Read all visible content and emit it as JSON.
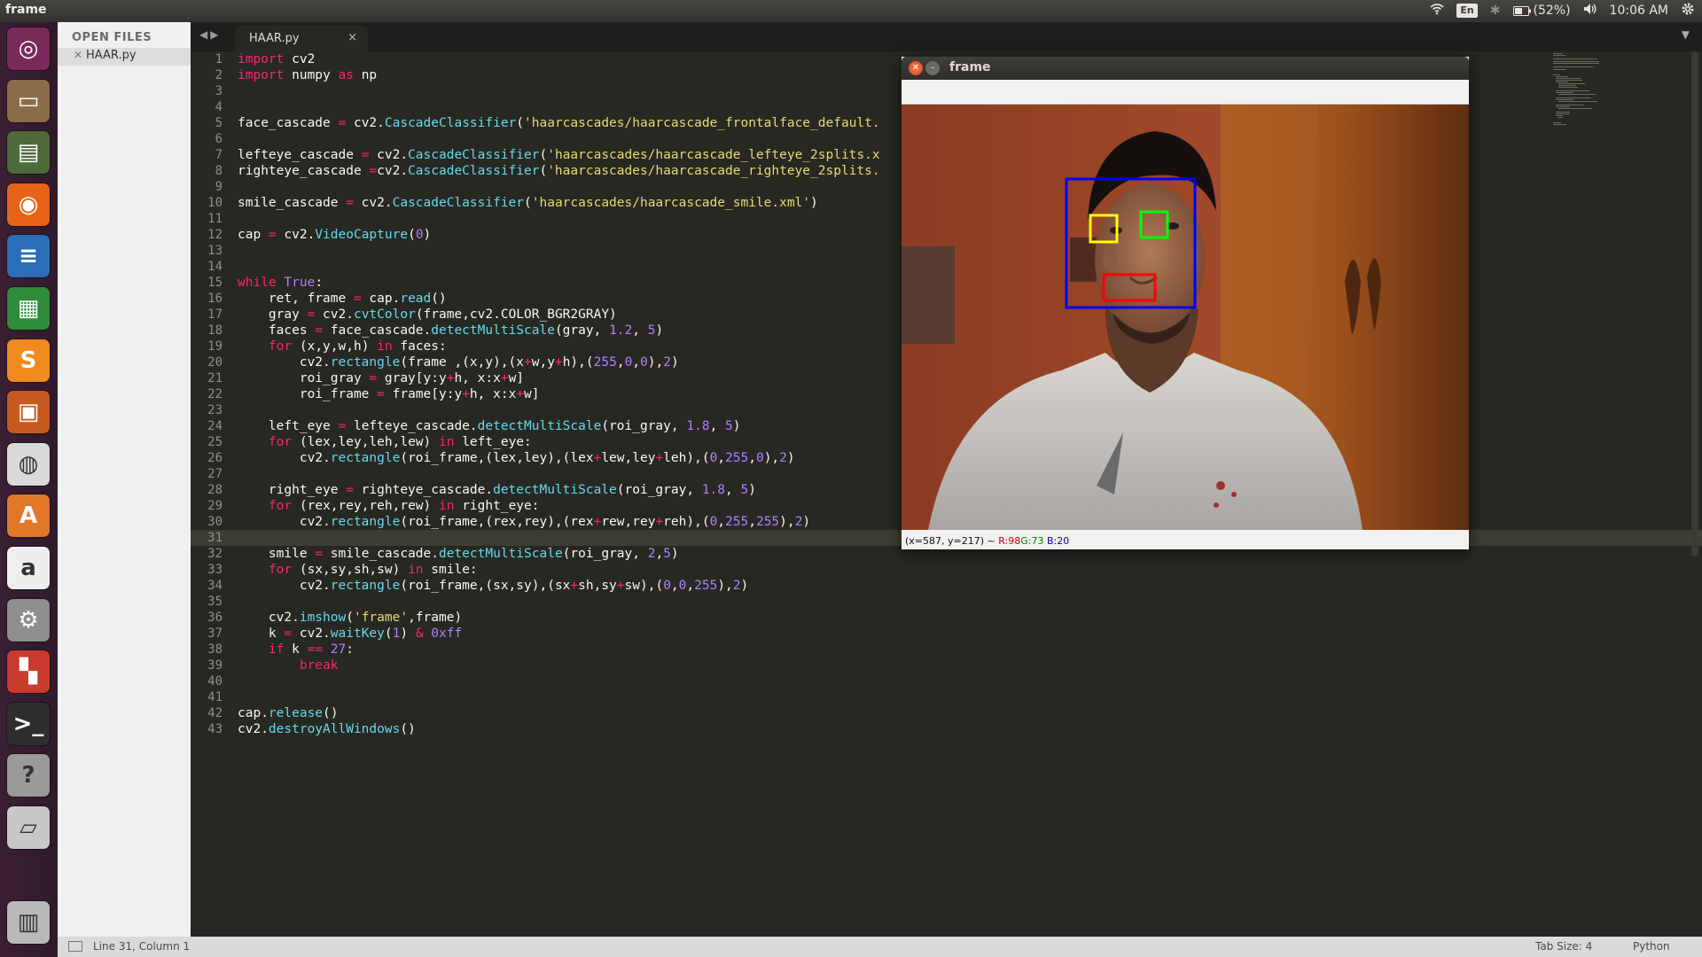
{
  "topbar": {
    "app_title": "frame",
    "keyboard_lang": "En",
    "battery": "(52%)",
    "clock": "10:06 AM"
  },
  "launcher": {
    "items": [
      {
        "name": "dash-icon",
        "bg": "#7a2a5a"
      },
      {
        "name": "files-icon",
        "bg": "#8a6e4a"
      },
      {
        "name": "disk-icon",
        "bg": "#4d6a3a"
      },
      {
        "name": "firefox-icon",
        "bg": "#e8631a"
      },
      {
        "name": "writer-icon",
        "bg": "#2a6fb8"
      },
      {
        "name": "calc-icon",
        "bg": "#2f8a3a"
      },
      {
        "name": "sublime-icon",
        "bg": "#f08a1c"
      },
      {
        "name": "impress-icon",
        "bg": "#c85a20"
      },
      {
        "name": "chrome-icon",
        "bg": "#d9d9d9"
      },
      {
        "name": "software-center-icon",
        "bg": "#e0782a"
      },
      {
        "name": "amazon-icon",
        "bg": "#eeeeee"
      },
      {
        "name": "settings-icon",
        "bg": "#8e8e8e"
      },
      {
        "name": "unity-tweak-icon",
        "bg": "#c93b2c"
      },
      {
        "name": "terminal-icon",
        "bg": "#2e2e2e"
      },
      {
        "name": "help-icon",
        "bg": "#9a9a9a"
      },
      {
        "name": "drive-icon",
        "bg": "#c8c8c8"
      },
      {
        "name": "trash-icon",
        "bg": "#b9b9b9"
      }
    ]
  },
  "sidebar": {
    "header": "OPEN FILES",
    "files": [
      "HAAR.py"
    ]
  },
  "tab": {
    "name": "HAAR.py",
    "close": "×"
  },
  "editor": {
    "current_line": 31,
    "line_numbers": [
      "1",
      "2",
      "3",
      "4",
      "5",
      "6",
      "7",
      "8",
      "9",
      "10",
      "11",
      "12",
      "13",
      "14",
      "15",
      "16",
      "17",
      "18",
      "19",
      "20",
      "21",
      "22",
      "23",
      "24",
      "25",
      "26",
      "27",
      "28",
      "29",
      "30",
      "31",
      "32",
      "33",
      "34",
      "35",
      "36",
      "37",
      "38",
      "39",
      "40",
      "41",
      "42",
      "43"
    ],
    "lines": [
      "import cv2",
      "import numpy as np",
      "",
      "",
      "face_cascade = cv2.CascadeClassifier('haarcascades/haarcascade_frontalface_default.",
      "",
      "lefteye_cascade = cv2.CascadeClassifier('haarcascades/haarcascade_lefteye_2splits.x",
      "righteye_cascade =cv2.CascadeClassifier('haarcascades/haarcascade_righteye_2splits.",
      "",
      "smile_cascade = cv2.CascadeClassifier('haarcascades/haarcascade_smile.xml')",
      "",
      "cap = cv2.VideoCapture(0)",
      "",
      "",
      "while True:",
      "    ret, frame = cap.read()",
      "    gray = cv2.cvtColor(frame,cv2.COLOR_BGR2GRAY)",
      "    faces = face_cascade.detectMultiScale(gray, 1.2, 5)",
      "    for (x,y,w,h) in faces:",
      "        cv2.rectangle(frame ,(x,y),(x+w,y+h),(255,0,0),2)",
      "        roi_gray = gray[y:y+h, x:x+w]",
      "        roi_frame = frame[y:y+h, x:x+w]",
      "",
      "    left_eye = lefteye_cascade.detectMultiScale(roi_gray, 1.8, 5)",
      "    for (lex,ley,leh,lew) in left_eye:",
      "        cv2.rectangle(roi_frame,(lex,ley),(lex+lew,ley+leh),(0,255,0),2)",
      "",
      "    right_eye = righteye_cascade.detectMultiScale(roi_gray, 1.8, 5)",
      "    for (rex,rey,reh,rew) in right_eye:",
      "        cv2.rectangle(roi_frame,(rex,rey),(rex+rew,rey+reh),(0,255,255),2)",
      "",
      "    smile = smile_cascade.detectMultiScale(roi_gray, 2,5)",
      "    for (sx,sy,sh,sw) in smile:",
      "        cv2.rectangle(roi_frame,(sx,sy),(sx+sh,sy+sw),(0,0,255),2)",
      "",
      "    cv2.imshow('frame',frame)",
      "    k = cv2.waitKey(1) & 0xff",
      "    if k == 27:",
      "        break",
      "",
      "",
      "cap.release()",
      "cv2.destroyAllWindows()"
    ]
  },
  "frame_window": {
    "title": "frame",
    "pixel_info": {
      "coords": "(x=587, y=217) ~",
      "r": "R:98",
      "g": "G:73",
      "b": "B:20"
    }
  },
  "statusbar": {
    "position": "Line 31, Column 1",
    "tab_size": "Tab Size: 4",
    "syntax": "Python"
  },
  "colors": {
    "face_box": "#0000ff",
    "left_eye_box": "#00ff00",
    "right_eye_box": "#ffff00",
    "smile_box": "#ff0000"
  }
}
